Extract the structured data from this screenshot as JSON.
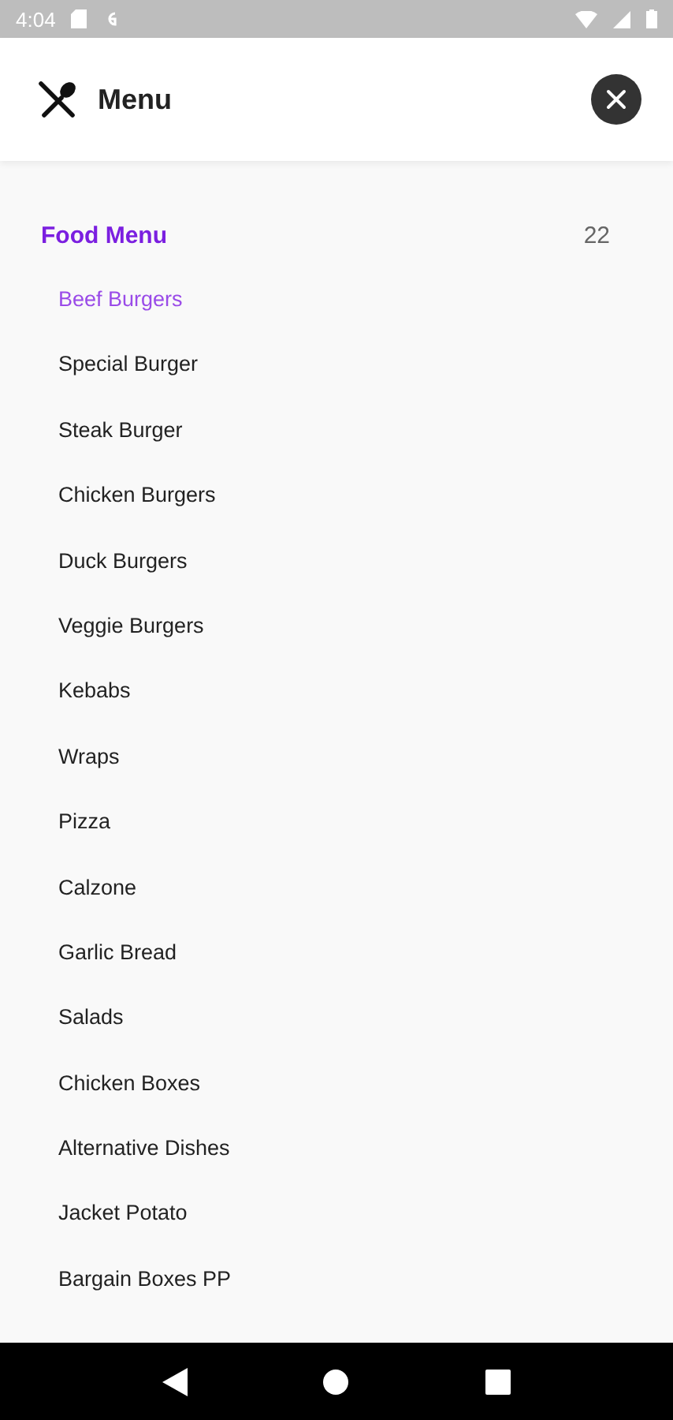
{
  "status_bar": {
    "time": "4:04"
  },
  "header": {
    "title": "Menu"
  },
  "section": {
    "title": "Food Menu",
    "count": "22"
  },
  "items": [
    {
      "label": "Beef Burgers",
      "selected": true
    },
    {
      "label": "Special Burger",
      "selected": false
    },
    {
      "label": "Steak Burger",
      "selected": false
    },
    {
      "label": "Chicken Burgers",
      "selected": false
    },
    {
      "label": "Duck Burgers",
      "selected": false
    },
    {
      "label": "Veggie Burgers",
      "selected": false
    },
    {
      "label": "Kebabs",
      "selected": false
    },
    {
      "label": "Wraps",
      "selected": false
    },
    {
      "label": "Pizza",
      "selected": false
    },
    {
      "label": "Calzone",
      "selected": false
    },
    {
      "label": "Garlic Bread",
      "selected": false
    },
    {
      "label": "Salads",
      "selected": false
    },
    {
      "label": "Chicken Boxes",
      "selected": false
    },
    {
      "label": "Alternative Dishes",
      "selected": false
    },
    {
      "label": "Jacket Potato",
      "selected": false
    },
    {
      "label": "Bargain Boxes PP",
      "selected": false
    }
  ]
}
